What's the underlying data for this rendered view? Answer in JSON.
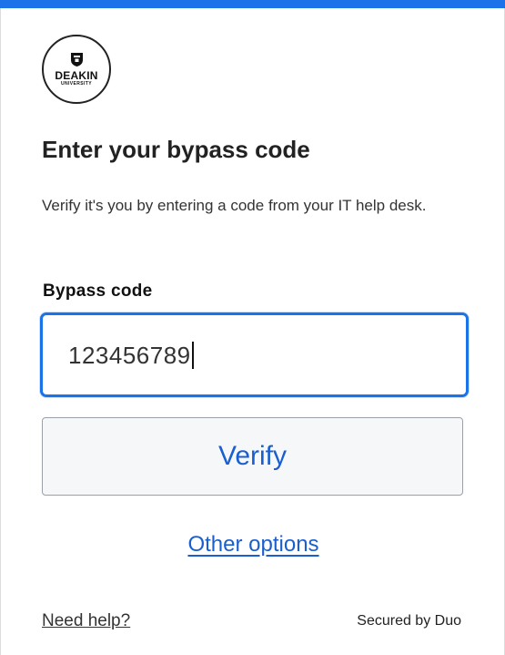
{
  "brand": {
    "logo_name": "DEAKIN",
    "logo_sub": "UNIVERSITY",
    "accent_color": "#1a73e8",
    "link_color": "#1a5fd0"
  },
  "header": {
    "title": "Enter your bypass code",
    "description": "Verify it's you by entering a code from your IT help desk."
  },
  "form": {
    "field_label": "Bypass code",
    "field_value": "123456789",
    "verify_label": "Verify",
    "other_options_label": "Other options"
  },
  "footer": {
    "help_label": "Need help?",
    "secured_by": "Secured by Duo"
  }
}
